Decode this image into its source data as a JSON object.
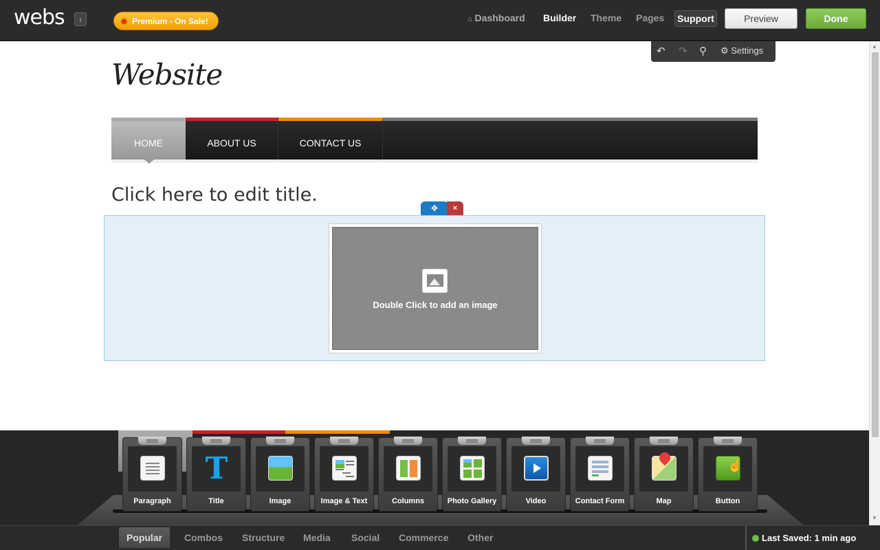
{
  "header": {
    "logo": "webs",
    "logo_toggle_icon": "↕",
    "premium_label": "Premium - On Sale!",
    "nav": {
      "dashboard": "Dashboard",
      "builder": "Builder",
      "theme": "Theme",
      "pages": "Pages",
      "support": "Support"
    },
    "preview_label": "Preview",
    "done_label": "Done"
  },
  "edit_tools": {
    "undo_icon": "↶",
    "redo_icon": "↷",
    "zoom_icon": "⚲",
    "settings_label": "⚙ Settings"
  },
  "site": {
    "title": "Website",
    "nav": [
      "HOME",
      "ABOUT US",
      "CONTACT US"
    ],
    "page_heading": "Click here to edit title.",
    "image_hint": "Double Click to add an image",
    "move_icon": "✥",
    "delete_icon": "×"
  },
  "elements": [
    {
      "label": "Paragraph",
      "icon": "paragraph-icon"
    },
    {
      "label": "Title",
      "icon": "title-icon"
    },
    {
      "label": "Image",
      "icon": "image-icon"
    },
    {
      "label": "Image & Text",
      "icon": "image-text-icon"
    },
    {
      "label": "Columns",
      "icon": "columns-icon"
    },
    {
      "label": "Photo Gallery",
      "icon": "gallery-icon"
    },
    {
      "label": "Video",
      "icon": "video-icon"
    },
    {
      "label": "Contact Form",
      "icon": "contact-form-icon"
    },
    {
      "label": "Map",
      "icon": "map-icon"
    },
    {
      "label": "Button",
      "icon": "button-icon"
    }
  ],
  "title_glyph": "T",
  "bottom_tabs": [
    "Popular",
    "Combos",
    "Structure",
    "Media",
    "Social",
    "Commerce",
    "Other"
  ],
  "active_tab": "Popular",
  "save_status": "Last Saved: 1 min ago",
  "colors": {
    "done": "#6cab3a",
    "premium": "#f0a000",
    "nav_red": "#c8202a",
    "nav_orange": "#f28a00",
    "selection": "#e3f0f8"
  }
}
